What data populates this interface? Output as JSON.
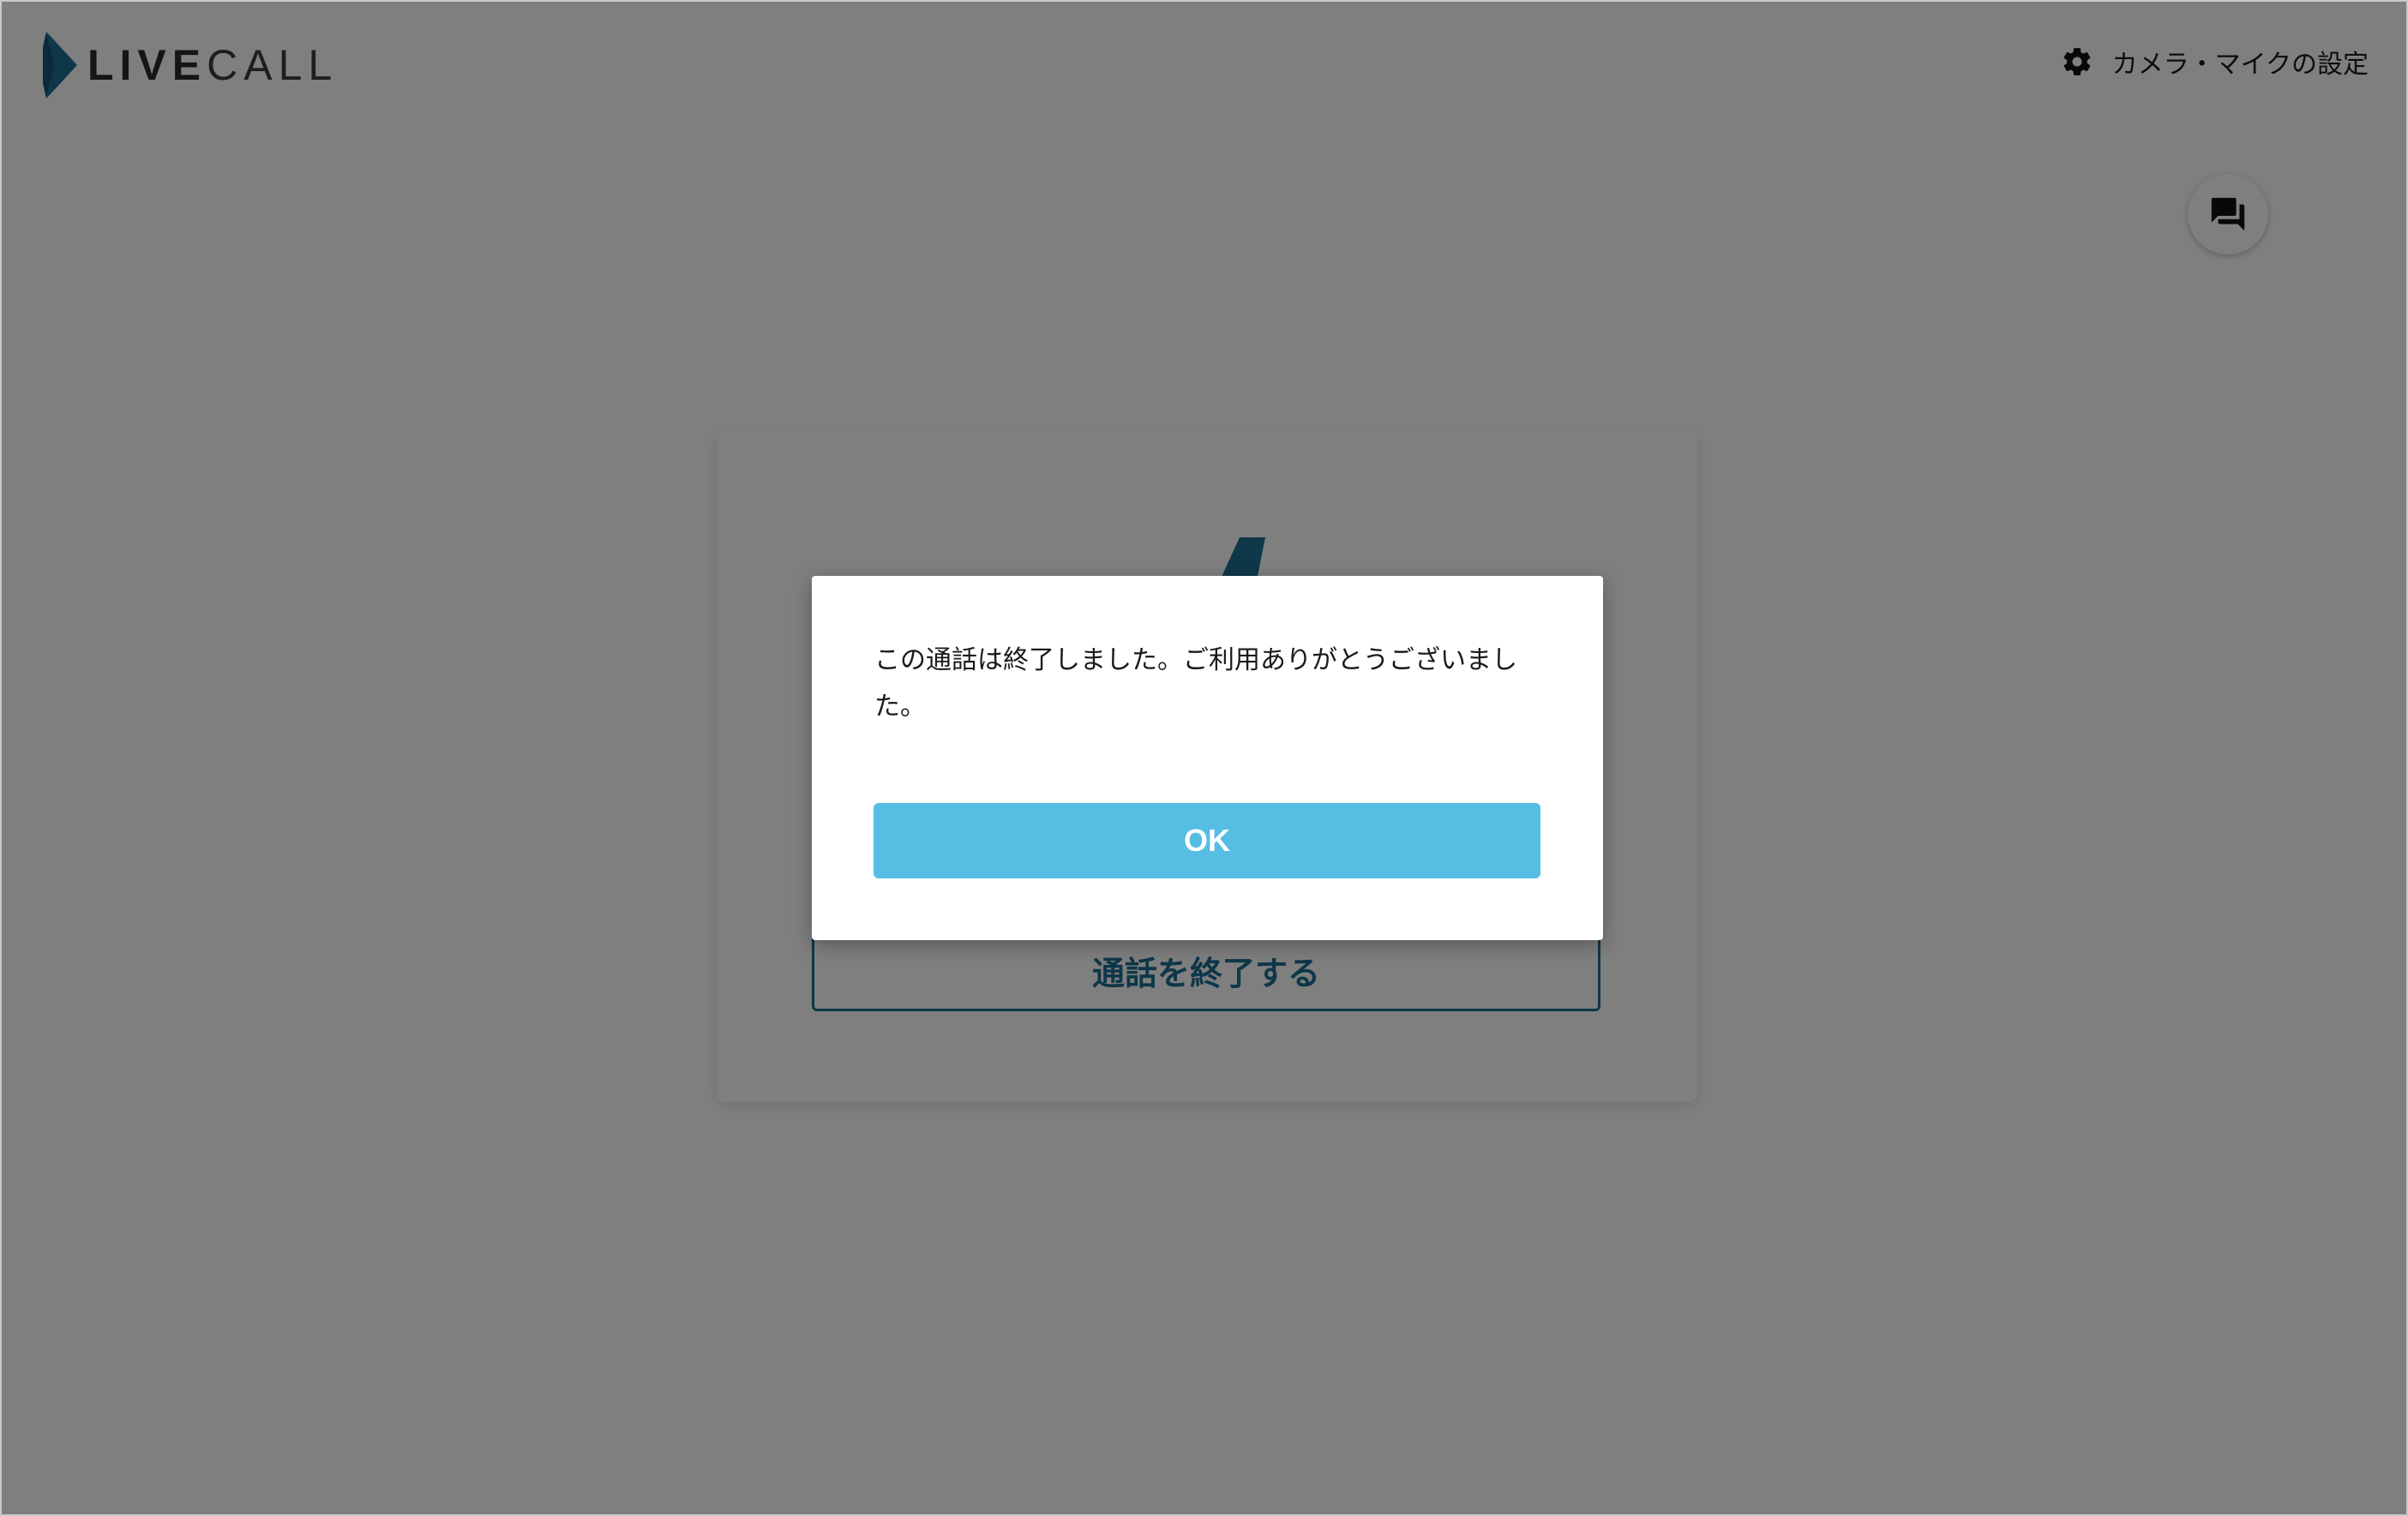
{
  "header": {
    "logo": {
      "text_strong": "LIVE",
      "text_light": "CALL",
      "color": "#1c6f93"
    },
    "settings": {
      "label": "カメラ・マイクの設定",
      "icon": "gear-icon"
    }
  },
  "chat_button": {
    "icon": "chat-icon"
  },
  "call_card": {
    "end_call_label": "通話を終了する",
    "accent_color": "#1c6f93"
  },
  "dialog": {
    "message": "この通話は終了しました。ご利用ありがとうございました。",
    "ok_label": "OK",
    "ok_color": "#56bde3"
  }
}
